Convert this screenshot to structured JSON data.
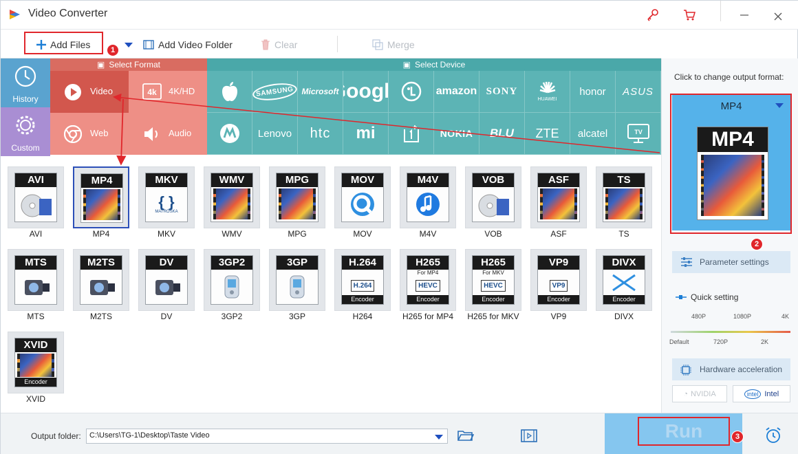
{
  "app": {
    "title": "Video Converter"
  },
  "toolbar": {
    "add_files": "Add Files",
    "add_folder": "Add Video Folder",
    "clear": "Clear",
    "merge": "Merge"
  },
  "left_nav": {
    "history": "History",
    "custom": "Custom"
  },
  "select_format": {
    "header": "Select Format",
    "items": [
      "Video",
      "4K/HD",
      "Web",
      "Audio"
    ]
  },
  "select_device": {
    "header": "Select Device",
    "brands": [
      "apple",
      "SAMSUNG",
      "Microsoft",
      "Google",
      "LG",
      "amazon",
      "SONY",
      "HUAWEI",
      "honor",
      "ASUS",
      "motorola",
      "Lenovo",
      "htc",
      "mi",
      "OnePlus",
      "NOKIA",
      "BLU",
      "ZTE",
      "alcatel",
      "TV"
    ]
  },
  "formats": [
    {
      "badge": "AVI",
      "label": "AVI"
    },
    {
      "badge": "MP4",
      "label": "MP4"
    },
    {
      "badge": "MKV",
      "label": "MKV",
      "sub": "MATROŠKA"
    },
    {
      "badge": "WMV",
      "label": "WMV"
    },
    {
      "badge": "MPG",
      "label": "MPG"
    },
    {
      "badge": "MOV",
      "label": "MOV"
    },
    {
      "badge": "M4V",
      "label": "M4V"
    },
    {
      "badge": "VOB",
      "label": "VOB"
    },
    {
      "badge": "ASF",
      "label": "ASF"
    },
    {
      "badge": "TS",
      "label": "TS"
    },
    {
      "badge": "MTS",
      "label": "MTS"
    },
    {
      "badge": "M2TS",
      "label": "M2TS"
    },
    {
      "badge": "DV",
      "label": "DV"
    },
    {
      "badge": "3GP2",
      "label": "3GP2"
    },
    {
      "badge": "3GP",
      "label": "3GP"
    },
    {
      "badge": "H.264",
      "label": "H264",
      "inner": "H.264",
      "enc": "Encoder"
    },
    {
      "badge": "H265",
      "label": "H265 for MP4",
      "sub": "For MP4",
      "inner": "HEVC",
      "enc": "Encoder"
    },
    {
      "badge": "H265",
      "label": "H265 for MKV",
      "sub": "For MKV",
      "inner": "HEVC",
      "enc": "Encoder"
    },
    {
      "badge": "VP9",
      "label": "VP9",
      "inner": "VP9",
      "enc": "Encoder"
    },
    {
      "badge": "DIVX",
      "label": "DIVX",
      "enc": "Encoder"
    },
    {
      "badge": "XVID",
      "label": "XVID",
      "enc": "Encoder"
    }
  ],
  "right_panel": {
    "title": "Click to change output format:",
    "output_format": "MP4",
    "parameter_settings": "Parameter settings",
    "quick_setting": "Quick setting",
    "ticks_top": [
      "480P",
      "1080P",
      "4K"
    ],
    "ticks_bottom": [
      "Default",
      "720P",
      "2K"
    ],
    "hardware_acceleration": "Hardware acceleration",
    "nvidia": "NVIDIA",
    "intel": "Intel"
  },
  "bottom": {
    "output_folder_label": "Output folder:",
    "output_folder_value": "C:\\Users\\TG-1\\Desktop\\Taste Video",
    "run": "Run"
  },
  "annotations": {
    "badge1": "1",
    "badge2": "2",
    "badge3": "3"
  },
  "colors": {
    "accent": "#2c4fb8",
    "annotation": "#e0262b",
    "format_red": "#d96c61",
    "device_teal": "#4aa8a9"
  }
}
